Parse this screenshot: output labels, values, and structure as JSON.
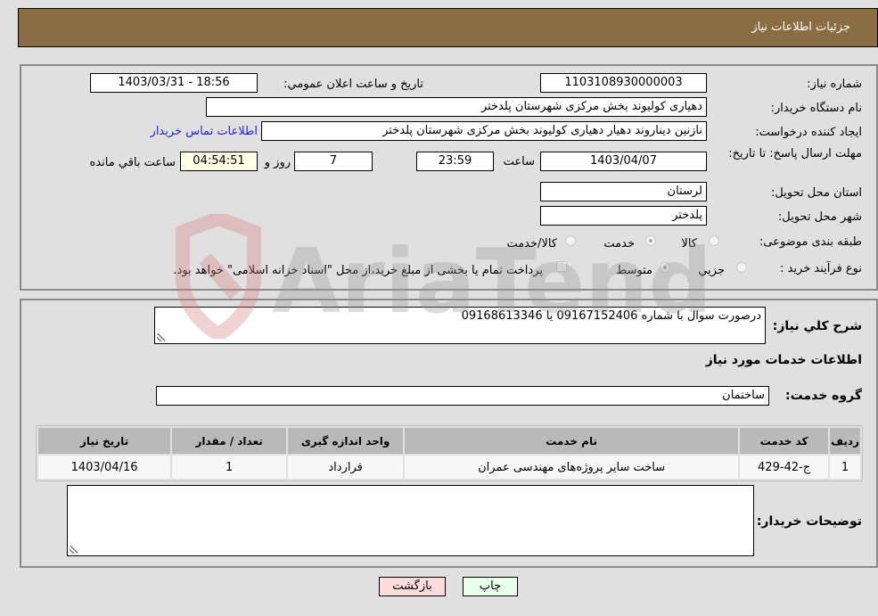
{
  "header": {
    "title": "جزئیات اطلاعات نیاز"
  },
  "form": {
    "need_number": {
      "label": "شماره نیاز:",
      "value": "1103108930000003"
    },
    "announce_datetime": {
      "label": "تاريخ و ساعت اعلان عمومي:",
      "value": "1403/03/31 - 18:56"
    },
    "buyer_org": {
      "label": "نام دستگاه خريدار:",
      "value": "دهیاری کولیوند بخش مرکزی شهرستان پلدختر"
    },
    "requester": {
      "label": "ايجاد کننده درخواست:",
      "value": "نازنین دیناروند دهیار دهیاری کولیوند بخش مرکزی شهرستان پلدختر"
    },
    "contact_link": "اطلاعات تماس خريدار",
    "deadline": {
      "label": "مهلت ارسال پاسخ: تا تاريخ:",
      "date": "1403/04/07",
      "time_label": "ساعت",
      "time": "23:59",
      "days": "7",
      "days_label": "روز و",
      "remaining": "04:54:51",
      "remaining_label": "ساعت باقي مانده"
    },
    "province": {
      "label": "استان محل تحويل:",
      "value": "لرستان"
    },
    "city": {
      "label": "شهر محل تحويل:",
      "value": "پلدختر"
    },
    "category": {
      "label": "طبقه بندی موضوعی:",
      "options": [
        "کالا",
        "خدمت",
        "کالا/خدمت"
      ],
      "selected": "خدمت"
    },
    "purchase_process": {
      "label": "نوع فرآيند خريد :",
      "options": [
        "جزيي",
        "متوسط"
      ],
      "selected": "متوسط",
      "treasury_checkbox_label": "پرداخت تمام يا بخشی از مبلغ خريد،از محل \"اسناد خزانه اسلامی\" خواهد بود.",
      "treasury_checked": false
    }
  },
  "details": {
    "description_label": "شرح کلي نياز:",
    "description": "درصورت سوال با شماره 09167152406 یا 09168613346",
    "services_heading": "اطلاعات خدمات مورد نیاز",
    "service_group_label": "گروه خدمت:",
    "service_group": "ساختمان",
    "table": {
      "headers": [
        "رديف",
        "کد خدمت",
        "نام خدمت",
        "واحد اندازه گيری",
        "تعداد / مقدار",
        "تاريخ نياز"
      ],
      "rows": [
        [
          "1",
          "ج-42-429",
          "ساخت سایر پروژه‌های مهندسی عمران",
          "قرارداد",
          "1",
          "1403/04/16"
        ]
      ]
    },
    "buyer_notes_label": "توضيحات خريدار:",
    "buyer_notes": ""
  },
  "buttons": {
    "print": "چاپ",
    "back": "بازگشت"
  },
  "watermark": "AriaTender.neT",
  "colors": {
    "header_bg": "#8b6d43",
    "print_bg": "#eaffea",
    "back_bg": "#ffdcdc",
    "link": "#2222dd"
  }
}
